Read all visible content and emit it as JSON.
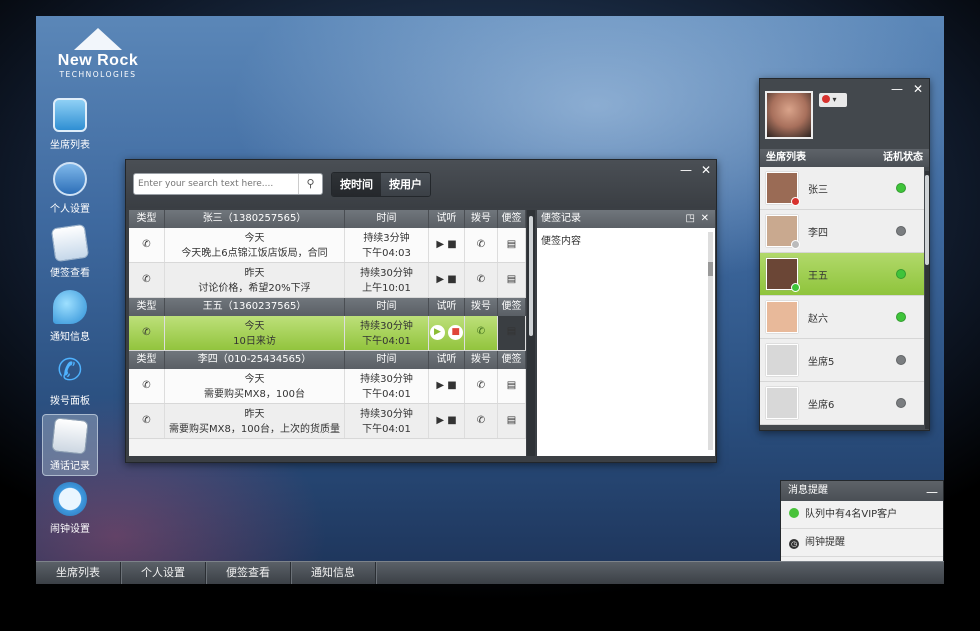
{
  "brand": {
    "name": "New Rock",
    "sub": "TECHNOLOGIES"
  },
  "dock": [
    {
      "label": "坐席列表",
      "icon": "contacts-icon"
    },
    {
      "label": "个人设置",
      "icon": "settings-icon"
    },
    {
      "label": "便签查看",
      "icon": "notes-icon"
    },
    {
      "label": "通知信息",
      "icon": "chat-bubble-icon"
    },
    {
      "label": "拨号面板",
      "icon": "phone-icon"
    },
    {
      "label": "通话记录",
      "icon": "call-records-icon"
    },
    {
      "label": "闹钟设置",
      "icon": "alarm-clock-icon"
    }
  ],
  "taskbar": [
    "坐席列表",
    "个人设置",
    "便签查看",
    "通知信息"
  ],
  "main_window": {
    "search_placeholder": "Enter your search text here....",
    "toggle": [
      "按时间",
      "按用户"
    ],
    "columns": {
      "type": "类型",
      "time": "时间",
      "listen": "试听",
      "dial": "拨号",
      "note": "便签"
    },
    "groups": [
      {
        "header": "张三（1380257565）",
        "rows": [
          {
            "call": "in",
            "line1": "今天",
            "line2": "今天晚上6点锦江饭店饭局，合同",
            "dur": "持续3分钟",
            "time": "下午04:03"
          },
          {
            "call": "in",
            "line1": "昨天",
            "line2": "讨论价格，希望20%下浮",
            "dur": "持续30分钟",
            "time": "上午10:01"
          }
        ]
      },
      {
        "header": "王五（1360237565）",
        "rows": [
          {
            "call": "in",
            "line1": "今天",
            "line2": "10日来访",
            "dur": "持续30分钟",
            "time": "下午04:01"
          }
        ]
      },
      {
        "header": "李四（010-25434565）",
        "rows": [
          {
            "call": "missed",
            "line1": "今天",
            "line2": "需要购买MX8，100台",
            "dur": "持续30分钟",
            "time": "下午04:01"
          },
          {
            "call": "in",
            "line1": "昨天",
            "line2": "需要购买MX8，100台，上次的货质量",
            "dur": "持续30分钟",
            "time": "下午04:01"
          }
        ]
      }
    ],
    "notes": {
      "title": "便签记录",
      "content": "便签内容"
    }
  },
  "contacts_panel": {
    "header_left": "坐席列表",
    "header_right": "话机状态",
    "items": [
      {
        "name": "张三",
        "status_color": "#3fc43a",
        "avatar": "#9a6b55"
      },
      {
        "name": "李四",
        "status_color": "#7a7d80",
        "avatar": "#c9a98f"
      },
      {
        "name": "王五",
        "status_color": "#3fc43a",
        "avatar": "#6b4636"
      },
      {
        "name": "赵六",
        "status_color": "#3fc43a",
        "avatar": "#e8b99a"
      },
      {
        "name": "坐席5",
        "status_color": "#7a7d80",
        "avatar": "#d8d8d8"
      },
      {
        "name": "坐席6",
        "status_color": "#7a7d80",
        "avatar": "#d8d8d8"
      }
    ]
  },
  "messages": {
    "title": "消息提醒",
    "items": [
      "队列中有4名VIP客户",
      "闹钟提醒"
    ]
  },
  "colors": {
    "accent_green": "#92c43d",
    "status_online": "#3fc43a",
    "status_offline": "#7a7d80",
    "missed_call": "#d9452f"
  }
}
